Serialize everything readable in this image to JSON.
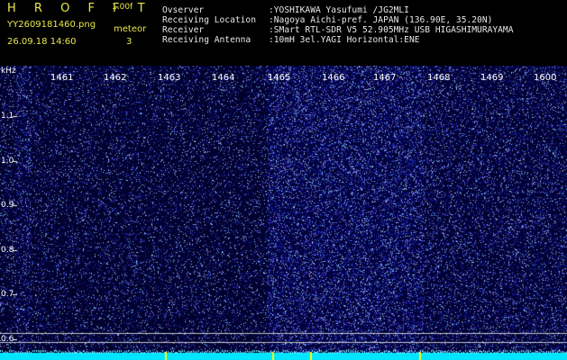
{
  "header": {
    "title": "H R O F F T",
    "version": "1.00f",
    "filename": "YY2609181460.png",
    "meteor_label": "meteor",
    "datetime": "26.09.18 14:60",
    "meteor_count": "3"
  },
  "info": [
    {
      "key": "Ovserver",
      "value": ":YOSHIKAWA Yasufumi /JG2MLI"
    },
    {
      "key": "Receiving Location",
      "value": ":Nagoya Aichi-pref. JAPAN (136.90E, 35.20N)"
    },
    {
      "key": "Receiver",
      "value": ":SMart RTL-SDR V5 52.905MHz USB HIGASHIMURAYAMA"
    },
    {
      "key": "Receiving Antenna",
      "value": ":10mH 3el.YAGI Horizontal:ENE"
    }
  ],
  "axis": {
    "y_unit": "kHz",
    "x_ticks": [
      "1461",
      "1462",
      "1463",
      "1464",
      "1465",
      "1466",
      "1467",
      "1468",
      "1469",
      "1600"
    ],
    "y_ticks": [
      "1.1",
      "1.0",
      "0.9",
      "0.8",
      "0.7",
      "0.6"
    ]
  },
  "colors": {
    "background": "#000000",
    "noise_dark": "#0a0a40",
    "noise_bright": "#3a3aff",
    "baseline": "#00e5ff",
    "header_yellow": "#e8e84a"
  }
}
